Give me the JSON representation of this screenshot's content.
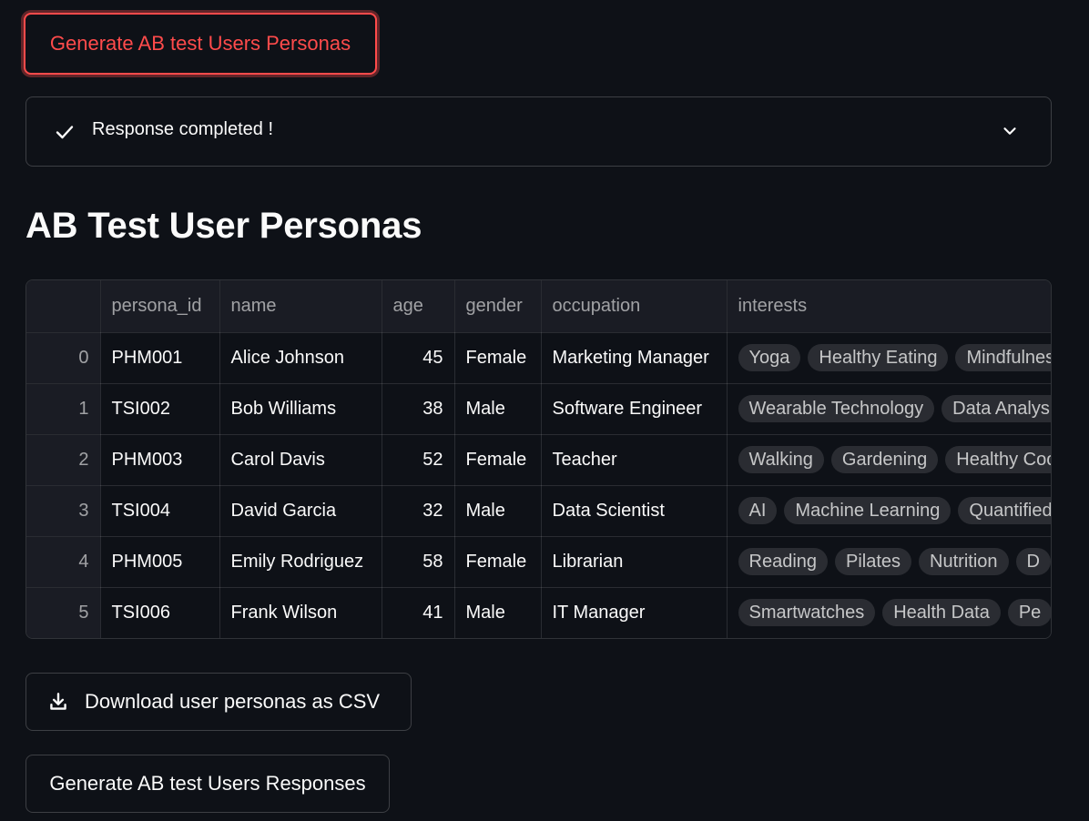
{
  "buttons": {
    "generate_personas": "Generate AB test Users Personas",
    "download_csv": "Download user personas as CSV",
    "generate_responses": "Generate AB test Users Responses"
  },
  "status": {
    "label": "Response completed !",
    "icon": "check-icon",
    "expand_icon": "chevron-down-icon"
  },
  "page": {
    "title": "AB Test User Personas"
  },
  "colors": {
    "background": "#0e1117",
    "accent": "#ff4b4b",
    "text": "#fafafa"
  },
  "table": {
    "columns": [
      "",
      "persona_id",
      "name",
      "age",
      "gender",
      "occupation",
      "interests"
    ],
    "rows": [
      {
        "index": "0",
        "persona_id": "PHM001",
        "name": "Alice Johnson",
        "age": "45",
        "gender": "Female",
        "occupation": "Marketing Manager",
        "interests": [
          "Yoga",
          "Healthy Eating",
          "Mindfulness"
        ]
      },
      {
        "index": "1",
        "persona_id": "TSI002",
        "name": "Bob Williams",
        "age": "38",
        "gender": "Male",
        "occupation": "Software Engineer",
        "interests": [
          "Wearable Technology",
          "Data Analysis"
        ]
      },
      {
        "index": "2",
        "persona_id": "PHM003",
        "name": "Carol Davis",
        "age": "52",
        "gender": "Female",
        "occupation": "Teacher",
        "interests": [
          "Walking",
          "Gardening",
          "Healthy Cooking"
        ]
      },
      {
        "index": "3",
        "persona_id": "TSI004",
        "name": "David Garcia",
        "age": "32",
        "gender": "Male",
        "occupation": "Data Scientist",
        "interests": [
          "AI",
          "Machine Learning",
          "Quantified Self"
        ]
      },
      {
        "index": "4",
        "persona_id": "PHM005",
        "name": "Emily Rodriguez",
        "age": "58",
        "gender": "Female",
        "occupation": "Librarian",
        "interests": [
          "Reading",
          "Pilates",
          "Nutrition",
          "D"
        ]
      },
      {
        "index": "5",
        "persona_id": "TSI006",
        "name": "Frank Wilson",
        "age": "41",
        "gender": "Male",
        "occupation": "IT Manager",
        "interests": [
          "Smartwatches",
          "Health Data",
          "Pe"
        ]
      }
    ]
  }
}
